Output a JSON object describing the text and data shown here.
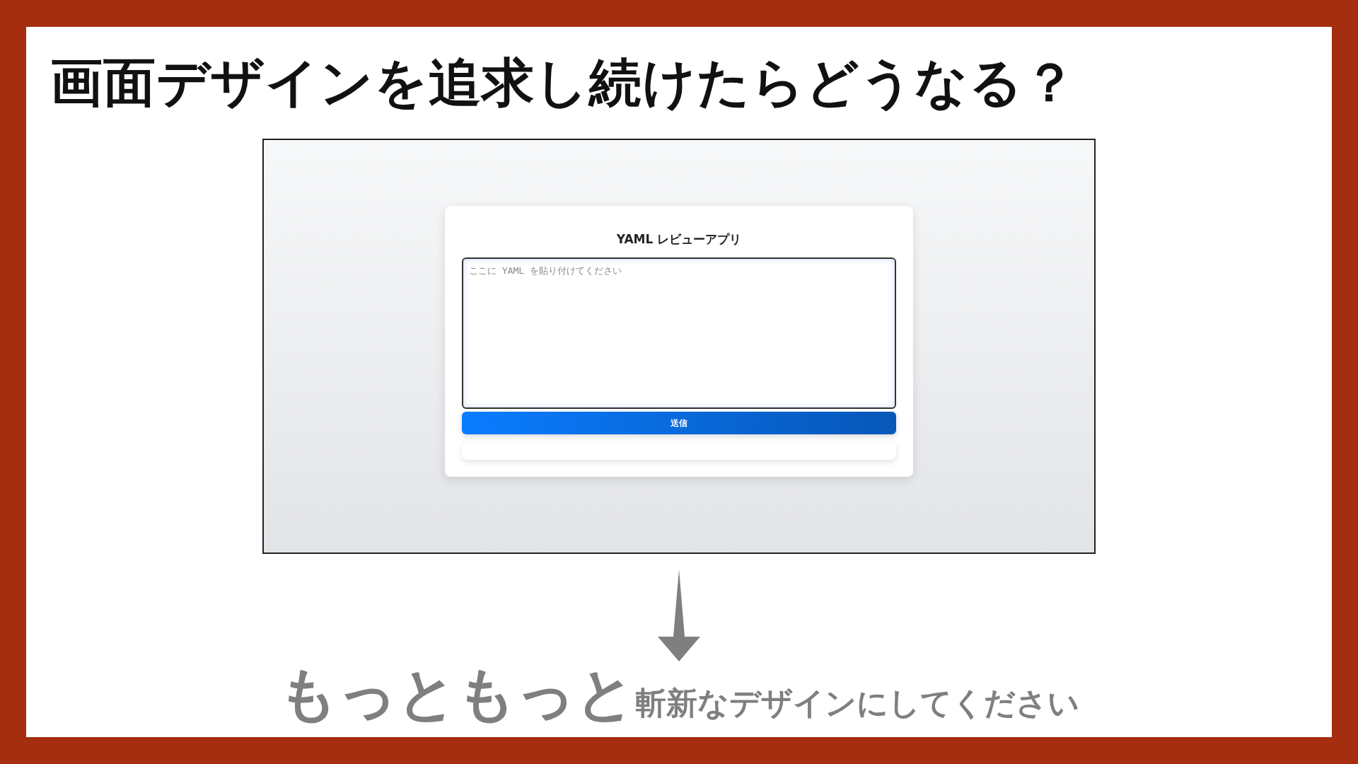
{
  "slide_title": "画面デザインを追求し続けたらどうなる？",
  "app": {
    "title": "YAML レビューアプリ",
    "input": {
      "placeholder": "ここに YAML を貼り付けてください"
    },
    "submit_button": "送信"
  },
  "prompt": {
    "emphasis": "もっともっと",
    "rest": "斬新なデザインにしてください"
  }
}
